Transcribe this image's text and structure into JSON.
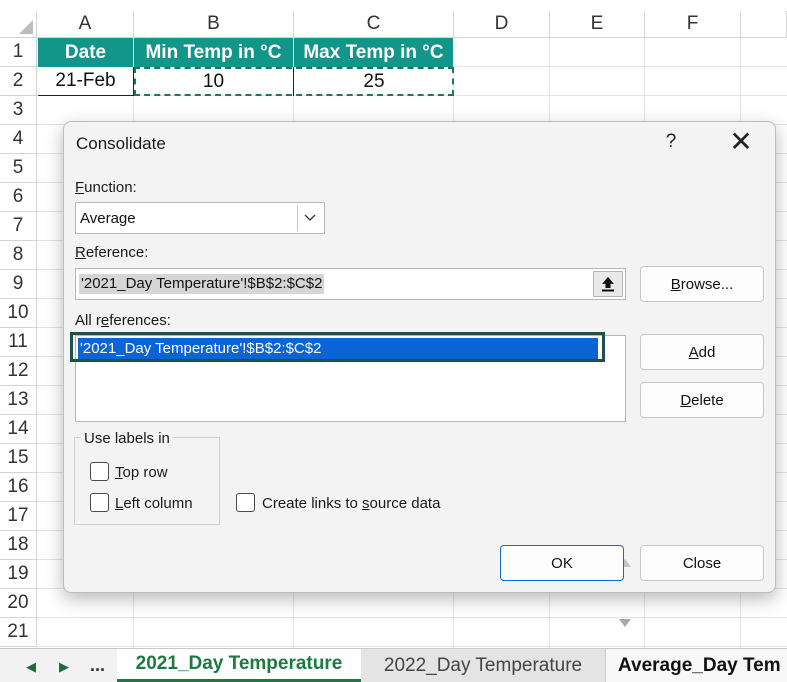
{
  "spreadsheet": {
    "columns": [
      "A",
      "B",
      "C",
      "D",
      "E",
      "F"
    ],
    "rows": [
      "1",
      "2",
      "3",
      "4",
      "5",
      "6",
      "7",
      "8",
      "9",
      "10",
      "11",
      "12",
      "13",
      "14",
      "15",
      "16",
      "17",
      "18",
      "19",
      "20",
      "21"
    ],
    "header_row": {
      "a1": "Date",
      "b1": "Min Temp in °C",
      "c1": "Max Temp in °C"
    },
    "data_row": {
      "a2": "21-Feb",
      "b2": "10",
      "c2": "25"
    },
    "accent_color": "#13968a"
  },
  "dialog": {
    "title": "Consolidate",
    "help": "?",
    "close": "✕",
    "function_label_u": "F",
    "function_label_rest": "unction:",
    "function_value": "Average",
    "reference_label_u": "R",
    "reference_label_rest": "eference:",
    "reference_value": "'2021_Day Temperature'!$B$2:$C$2",
    "browse_button_u": "B",
    "browse_button_rest": "rowse...",
    "all_references_label_pre": "All r",
    "all_references_label_u": "e",
    "all_references_label_post": "ferences:",
    "all_references_items": [
      "'2021_Day Temperature'!$B$2:$C$2"
    ],
    "add_button_u": "A",
    "add_button_rest": "dd",
    "delete_button_u": "D",
    "delete_button_rest": "elete",
    "use_labels_label": "Use labels in",
    "top_row_u": "T",
    "top_row_rest": "op row",
    "left_column_u": "L",
    "left_column_rest": "eft column",
    "create_links_pre": "Create links to ",
    "create_links_u": "s",
    "create_links_post": "ource data",
    "checkboxes": {
      "top_row": false,
      "left_column": false,
      "create_links": false
    },
    "ok_button": "OK",
    "close_button": "Close"
  },
  "sheet_tabs": {
    "nav_prev": "◀",
    "nav_next": "▶",
    "nav_more": "...",
    "tabs": [
      "2021_Day Temperature",
      "2022_Day Temperature",
      "Average_Day Tem"
    ],
    "active_tab": "2021_Day Temperature"
  }
}
